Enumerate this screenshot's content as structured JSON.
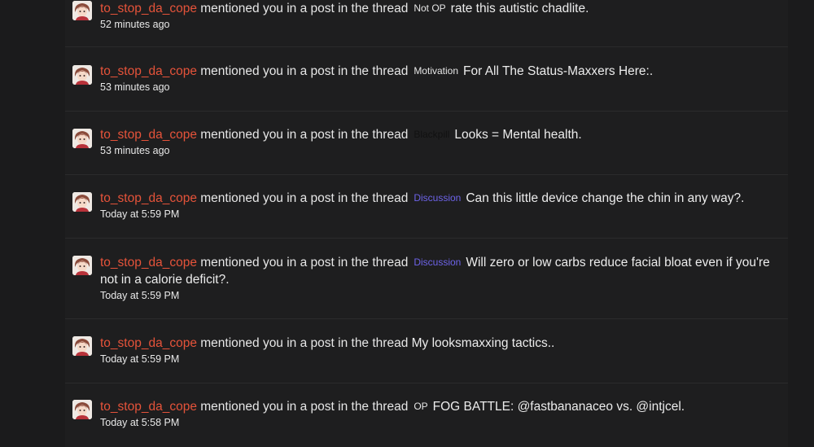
{
  "alerts": [
    {
      "user": "to_stop_da_cope",
      "action": "mentioned you in a post in the thread",
      "prefix": "Not OP",
      "prefix_style": "default",
      "title": "rate this autistic chadlite.",
      "time": "52 minutes ago"
    },
    {
      "user": "to_stop_da_cope",
      "action": "mentioned you in a post in the thread",
      "prefix": "Motivation",
      "prefix_style": "default",
      "title": "For All The Status-Maxxers Here:.",
      "time": "53 minutes ago"
    },
    {
      "user": "to_stop_da_cope",
      "action": "mentioned you in a post in the thread",
      "prefix": "Blackpill",
      "prefix_style": "blackpill",
      "title": "Looks = Mental health.",
      "time": "53 minutes ago"
    },
    {
      "user": "to_stop_da_cope",
      "action": "mentioned you in a post in the thread",
      "prefix": "Discussion",
      "prefix_style": "discussion",
      "title": "Can this little device change the chin in any way?.",
      "time": "Today at 5:59 PM"
    },
    {
      "user": "to_stop_da_cope",
      "action": "mentioned you in a post in the thread",
      "prefix": "Discussion",
      "prefix_style": "discussion",
      "title": "Will zero or low carbs reduce facial bloat even if you're not in a calorie deficit?.",
      "time": "Today at 5:59 PM"
    },
    {
      "user": "to_stop_da_cope",
      "action": "mentioned you in a post in the thread",
      "prefix": "",
      "prefix_style": "none",
      "title": "My looksmaxxing tactics..",
      "time": "Today at 5:59 PM"
    },
    {
      "user": "to_stop_da_cope",
      "action": "mentioned you in a post in the thread",
      "prefix": "OP",
      "prefix_style": "default",
      "title": "FOG BATTLE: @fastbananaceo vs. @intjcel.",
      "time": "Today at 5:58 PM"
    }
  ],
  "colors": {
    "background": "#1b1b1c",
    "panel": "#1e1e1f",
    "username": "#e5533a",
    "discussion_prefix": "#6d63e8"
  },
  "icons": {
    "avatar": "anime-avatar-icon"
  }
}
